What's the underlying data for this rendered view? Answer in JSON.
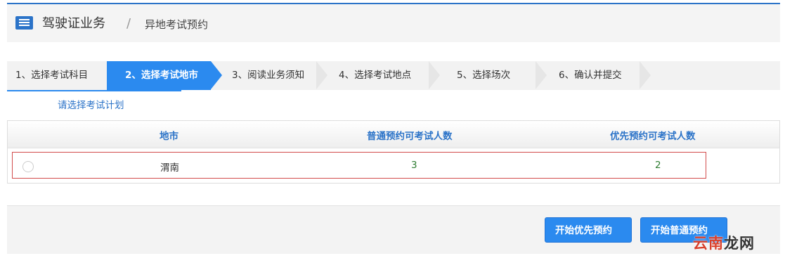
{
  "breadcrumb": {
    "title": "驾驶证业务",
    "separator": "/",
    "current": "异地考试预约"
  },
  "steps": [
    {
      "label": "1、选择考试科目",
      "active": false
    },
    {
      "label": "2、选择考试地市",
      "active": true
    },
    {
      "label": "3、阅读业务须知",
      "active": false
    },
    {
      "label": "4、选择考试地点",
      "active": false
    },
    {
      "label": "5、选择场次",
      "active": false
    },
    {
      "label": "6、确认并提交",
      "active": false
    }
  ],
  "hint": "请选择考试计划",
  "table": {
    "headers": [
      "地市",
      "普通预约可考试人数",
      "优先预约可考试人数"
    ],
    "rows": [
      {
        "city": "渭南",
        "normal": "3",
        "priority": "2",
        "selected": false
      }
    ]
  },
  "buttons": {
    "priority": "开始优先预约",
    "normal": "开始普通预约"
  },
  "watermark": {
    "part1": "云南",
    "part2": "龙网"
  },
  "colors": {
    "accent": "#2b8aef",
    "highlight_border": "#d24b4b"
  }
}
